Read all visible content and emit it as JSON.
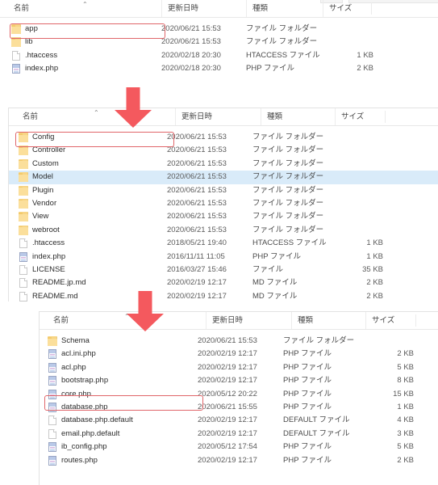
{
  "columns": {
    "name": "名前",
    "date": "更新日時",
    "type": "種類",
    "size": "サイズ",
    "sort_caret": "⌃"
  },
  "types": {
    "folder": "ファイル フォルダー",
    "htaccess": "HTACCESS ファイル",
    "php": "PHP ファイル",
    "file": "ファイル",
    "md": "MD ファイル",
    "default": "DEFAULT ファイル"
  },
  "colors": {
    "highlight_box": "#e0666a",
    "arrow": "#f4595e",
    "row_hover": "#d9ebf9",
    "folder_icon": "#f7d585"
  },
  "panels": [
    {
      "id": "panel-root",
      "rows": [
        {
          "icon": "folder-icon",
          "name": "app",
          "date": "2020/06/21 15:53",
          "type": "ファイル フォルダー",
          "size": "",
          "highlighted": true,
          "hovered": false
        },
        {
          "icon": "folder-icon",
          "name": "lib",
          "date": "2020/06/21 15:53",
          "type": "ファイル フォルダー",
          "size": "",
          "highlighted": false,
          "hovered": false
        },
        {
          "icon": "file-icon",
          "name": ".htaccess",
          "date": "2020/02/18 20:30",
          "type": "HTACCESS ファイル",
          "size": "1 KB",
          "highlighted": false,
          "hovered": false
        },
        {
          "icon": "php-file-icon",
          "name": "index.php",
          "date": "2020/02/18 20:30",
          "type": "PHP ファイル",
          "size": "2 KB",
          "highlighted": false,
          "hovered": false
        }
      ]
    },
    {
      "id": "panel-app",
      "rows": [
        {
          "icon": "folder-icon",
          "name": "Config",
          "date": "2020/06/21 15:53",
          "type": "ファイル フォルダー",
          "size": "",
          "highlighted": true,
          "hovered": false
        },
        {
          "icon": "folder-icon",
          "name": "Controller",
          "date": "2020/06/21 15:53",
          "type": "ファイル フォルダー",
          "size": "",
          "highlighted": false,
          "hovered": false
        },
        {
          "icon": "folder-icon",
          "name": "Custom",
          "date": "2020/06/21 15:53",
          "type": "ファイル フォルダー",
          "size": "",
          "highlighted": false,
          "hovered": false
        },
        {
          "icon": "folder-icon",
          "name": "Model",
          "date": "2020/06/21 15:53",
          "type": "ファイル フォルダー",
          "size": "",
          "highlighted": false,
          "hovered": true
        },
        {
          "icon": "folder-icon",
          "name": "Plugin",
          "date": "2020/06/21 15:53",
          "type": "ファイル フォルダー",
          "size": "",
          "highlighted": false,
          "hovered": false
        },
        {
          "icon": "folder-icon",
          "name": "Vendor",
          "date": "2020/06/21 15:53",
          "type": "ファイル フォルダー",
          "size": "",
          "highlighted": false,
          "hovered": false
        },
        {
          "icon": "folder-icon",
          "name": "View",
          "date": "2020/06/21 15:53",
          "type": "ファイル フォルダー",
          "size": "",
          "highlighted": false,
          "hovered": false
        },
        {
          "icon": "folder-icon",
          "name": "webroot",
          "date": "2020/06/21 15:53",
          "type": "ファイル フォルダー",
          "size": "",
          "highlighted": false,
          "hovered": false
        },
        {
          "icon": "file-icon",
          "name": ".htaccess",
          "date": "2018/05/21 19:40",
          "type": "HTACCESS ファイル",
          "size": "1 KB",
          "highlighted": false,
          "hovered": false
        },
        {
          "icon": "php-file-icon",
          "name": "index.php",
          "date": "2016/11/11 11:05",
          "type": "PHP ファイル",
          "size": "1 KB",
          "highlighted": false,
          "hovered": false
        },
        {
          "icon": "file-icon",
          "name": "LICENSE",
          "date": "2016/03/27 15:46",
          "type": "ファイル",
          "size": "35 KB",
          "highlighted": false,
          "hovered": false
        },
        {
          "icon": "file-icon",
          "name": "README.jp.md",
          "date": "2020/02/19 12:17",
          "type": "MD ファイル",
          "size": "2 KB",
          "highlighted": false,
          "hovered": false
        },
        {
          "icon": "file-icon",
          "name": "README.md",
          "date": "2020/02/19 12:17",
          "type": "MD ファイル",
          "size": "2 KB",
          "highlighted": false,
          "hovered": false
        }
      ]
    },
    {
      "id": "panel-config",
      "rows": [
        {
          "icon": "folder-icon",
          "name": "Schema",
          "date": "2020/06/21 15:53",
          "type": "ファイル フォルダー",
          "size": "",
          "highlighted": false,
          "hovered": false
        },
        {
          "icon": "php-file-icon",
          "name": "acl.ini.php",
          "date": "2020/02/19 12:17",
          "type": "PHP ファイル",
          "size": "2 KB",
          "highlighted": false,
          "hovered": false
        },
        {
          "icon": "php-file-icon",
          "name": "acl.php",
          "date": "2020/02/19 12:17",
          "type": "PHP ファイル",
          "size": "5 KB",
          "highlighted": false,
          "hovered": false
        },
        {
          "icon": "php-file-icon",
          "name": "bootstrap.php",
          "date": "2020/02/19 12:17",
          "type": "PHP ファイル",
          "size": "8 KB",
          "highlighted": false,
          "hovered": false
        },
        {
          "icon": "php-file-icon",
          "name": "core.php",
          "date": "2020/05/12 20:22",
          "type": "PHP ファイル",
          "size": "15 KB",
          "highlighted": false,
          "hovered": false
        },
        {
          "icon": "php-file-icon",
          "name": "database.php",
          "date": "2020/06/21 15:55",
          "type": "PHP ファイル",
          "size": "1 KB",
          "highlighted": true,
          "hovered": false
        },
        {
          "icon": "file-icon",
          "name": "database.php.default",
          "date": "2020/02/19 12:17",
          "type": "DEFAULT ファイル",
          "size": "4 KB",
          "highlighted": false,
          "hovered": false
        },
        {
          "icon": "file-icon",
          "name": "email.php.default",
          "date": "2020/02/19 12:17",
          "type": "DEFAULT ファイル",
          "size": "3 KB",
          "highlighted": false,
          "hovered": false
        },
        {
          "icon": "php-file-icon",
          "name": "ib_config.php",
          "date": "2020/05/12 17:54",
          "type": "PHP ファイル",
          "size": "5 KB",
          "highlighted": false,
          "hovered": false
        },
        {
          "icon": "php-file-icon",
          "name": "routes.php",
          "date": "2020/02/19 12:17",
          "type": "PHP ファイル",
          "size": "2 KB",
          "highlighted": false,
          "hovered": false
        }
      ]
    }
  ],
  "arrows": [
    {
      "name": "down-arrow-root-to-app"
    },
    {
      "name": "down-arrow-app-to-config"
    }
  ]
}
